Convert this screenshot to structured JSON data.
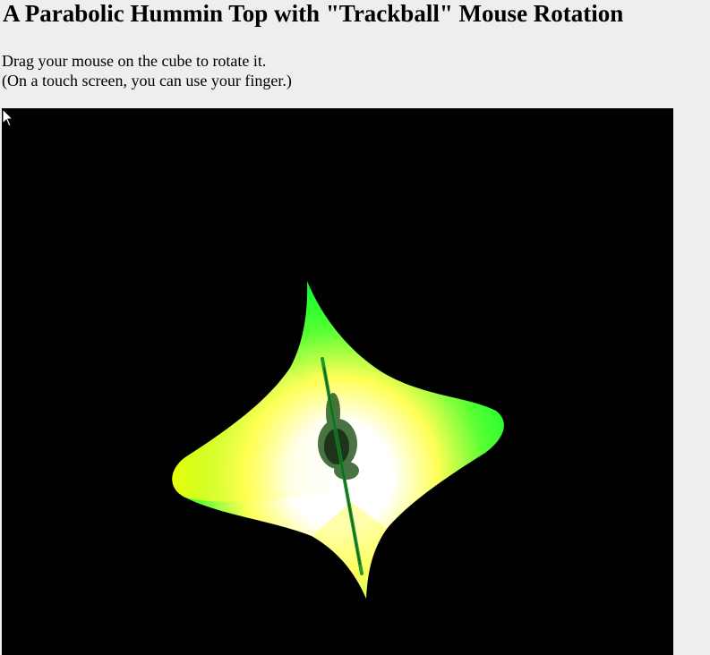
{
  "page": {
    "title": "A Parabolic Hummin Top with \"Trackball\" Mouse Rotation",
    "instructions": [
      "Drag your mouse on the cube to rotate it.",
      "(On a touch screen, you can use your finger.)"
    ]
  },
  "canvas": {
    "background_color": "#000000",
    "object": "parabolic-hummin-top",
    "colors": {
      "edge": "#1aff33",
      "mid": "#ffff33",
      "center": "#ffffff",
      "axis": "#0b8f2a"
    }
  }
}
